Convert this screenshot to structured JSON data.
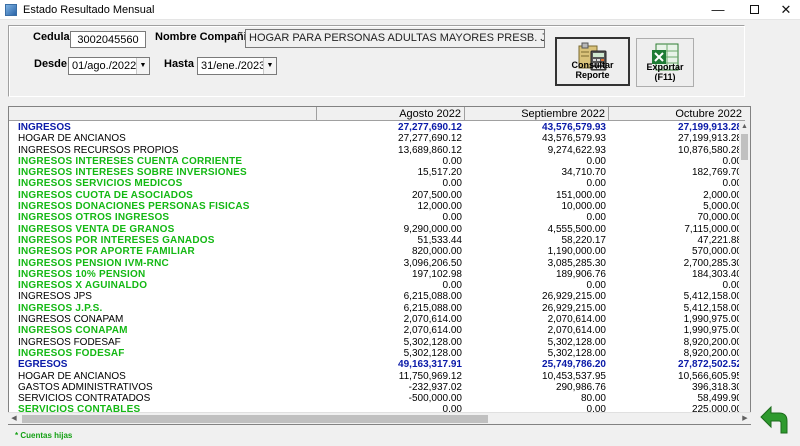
{
  "window": {
    "title": "Estado Resultado Mensual",
    "minimize": "—",
    "close": "✕"
  },
  "filters": {
    "cedula_label": "Cedula",
    "cedula_value": "3002045560",
    "company_label": "Nombre Compañia",
    "company_value": "HOGAR PARA PERSONAS ADULTAS MAYORES  PRESB. JESU",
    "desde_label": "Desde",
    "desde_value": "01/ago./2022",
    "hasta_label": "Hasta",
    "hasta_value": "31/ene./2023"
  },
  "buttons": {
    "consultar": "Consultar Reporte",
    "exportar": "Exportar (F11)"
  },
  "grid": {
    "columns": [
      "",
      "Agosto 2022",
      "Septiembre 2022",
      "Octubre 2022"
    ],
    "rows": [
      {
        "name": "INGRESOS",
        "style": "head",
        "v": [
          "27,277,690.12",
          "43,576,579.93",
          "27,199,913.28"
        ]
      },
      {
        "name": "HOGAR DE ANCIANOS",
        "style": "normal",
        "v": [
          "27,277,690.12",
          "43,576,579.93",
          "27,199,913.28"
        ]
      },
      {
        "name": "INGRESOS RECURSOS PROPIOS",
        "style": "normal",
        "v": [
          "13,689,860.12",
          "9,274,622.93",
          "10,876,580.28"
        ]
      },
      {
        "name": "INGRESOS INTERESES CUENTA CORRIENTE",
        "style": "green",
        "v": [
          "0.00",
          "0.00",
          "0.00"
        ]
      },
      {
        "name": "INGRESOS INTERESES SOBRE INVERSIONES",
        "style": "green",
        "v": [
          "15,517.20",
          "34,710.70",
          "182,769.70"
        ]
      },
      {
        "name": "INGRESOS SERVICIOS MEDICOS",
        "style": "green",
        "v": [
          "0.00",
          "0.00",
          "0.00"
        ]
      },
      {
        "name": "INGRESOS CUOTA DE ASOCIADOS",
        "style": "green",
        "v": [
          "207,500.00",
          "151,000.00",
          "2,000.00"
        ]
      },
      {
        "name": "INGRESOS DONACIONES PERSONAS FISICAS",
        "style": "green",
        "v": [
          "12,000.00",
          "10,000.00",
          "5,000.00"
        ]
      },
      {
        "name": "INGRESOS OTROS INGRESOS",
        "style": "green",
        "v": [
          "0.00",
          "0.00",
          "70,000.00"
        ]
      },
      {
        "name": "INGRESOS VENTA DE GRANOS",
        "style": "green",
        "v": [
          "9,290,000.00",
          "4,555,500.00",
          "7,115,000.00"
        ]
      },
      {
        "name": "INGRESOS POR INTERESES GANADOS",
        "style": "green",
        "v": [
          "51,533.44",
          "58,220.17",
          "47,221.88"
        ]
      },
      {
        "name": "INGRESOS POR APORTE FAMILIAR",
        "style": "green",
        "v": [
          "820,000.00",
          "1,190,000.00",
          "570,000.00"
        ]
      },
      {
        "name": "INGRESOS PENSION IVM-RNC",
        "style": "green",
        "v": [
          "3,096,206.50",
          "3,085,285.30",
          "2,700,285.30"
        ]
      },
      {
        "name": "INGRESOS 10% PENSION",
        "style": "green",
        "v": [
          "197,102.98",
          "189,906.76",
          "184,303.40"
        ]
      },
      {
        "name": "INGRESOS X AGUINALDO",
        "style": "green",
        "v": [
          "0.00",
          "0.00",
          "0.00"
        ]
      },
      {
        "name": "INGRESOS JPS",
        "style": "normal",
        "v": [
          "6,215,088.00",
          "26,929,215.00",
          "5,412,158.00"
        ]
      },
      {
        "name": "INGRESOS J.P.S.",
        "style": "green",
        "v": [
          "6,215,088.00",
          "26,929,215.00",
          "5,412,158.00"
        ]
      },
      {
        "name": "INGRESOS CONAPAM",
        "style": "normal",
        "v": [
          "2,070,614.00",
          "2,070,614.00",
          "1,990,975.00"
        ]
      },
      {
        "name": "INGRESOS CONAPAM",
        "style": "green",
        "v": [
          "2,070,614.00",
          "2,070,614.00",
          "1,990,975.00"
        ]
      },
      {
        "name": "INGRESOS FODESAF",
        "style": "normal",
        "v": [
          "5,302,128.00",
          "5,302,128.00",
          "8,920,200.00"
        ]
      },
      {
        "name": "INGRESOS FODESAF",
        "style": "green",
        "v": [
          "5,302,128.00",
          "5,302,128.00",
          "8,920,200.00"
        ]
      },
      {
        "name": "EGRESOS",
        "style": "head",
        "v": [
          "49,163,317.91",
          "25,749,786.20",
          "27,872,502.52"
        ]
      },
      {
        "name": "HOGAR DE ANCIANOS",
        "style": "normal",
        "v": [
          "11,750,969.12",
          "10,453,537.95",
          "10,566,605.95"
        ]
      },
      {
        "name": "GASTOS ADMINISTRATIVOS",
        "style": "normal",
        "v": [
          "-232,937.02",
          "290,986.76",
          "396,318.30"
        ]
      },
      {
        "name": "SERVICIOS CONTRATADOS",
        "style": "normal",
        "v": [
          "-500,000.00",
          "80.00",
          "58,499.90"
        ]
      },
      {
        "name": "SERVICIOS CONTABLES",
        "style": "green",
        "v": [
          "0.00",
          "0.00",
          "225,000.00"
        ]
      }
    ]
  },
  "footer": {
    "note": "* Cuentas hijas"
  },
  "icons": {
    "window": "app-icon",
    "consultar": "report-calculator-icon",
    "exportar": "excel-icon",
    "back": "back-arrow-icon"
  },
  "colors": {
    "head": "#0a1aa8",
    "green": "#14b814",
    "back_arrow": "#2e9a2e"
  }
}
